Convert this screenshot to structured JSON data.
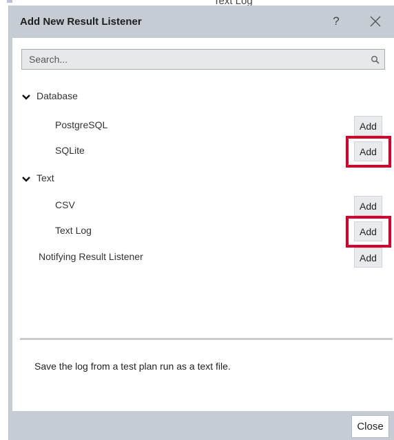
{
  "backdrop": {
    "partial_text": "Text Log"
  },
  "dialog": {
    "title": "Add New Result Listener",
    "help_label": "?",
    "close_label": "Close"
  },
  "search": {
    "placeholder": "Search...",
    "value": ""
  },
  "tree": {
    "groups": [
      {
        "label": "Database",
        "expanded": true,
        "items": [
          {
            "label": "PostgreSQL",
            "action": "Add",
            "highlighted": false
          },
          {
            "label": "SQLite",
            "action": "Add",
            "highlighted": true
          }
        ]
      },
      {
        "label": "Text",
        "expanded": true,
        "items": [
          {
            "label": "CSV",
            "action": "Add",
            "highlighted": false
          },
          {
            "label": "Text Log",
            "action": "Add",
            "highlighted": true
          }
        ]
      }
    ],
    "standalone": [
      {
        "label": "Notifying Result Listener",
        "action": "Add",
        "highlighted": false
      }
    ]
  },
  "description": "Save the log from a test plan run as a text file.",
  "colors": {
    "dialog_bg": "#c6ccd3",
    "panel_bg": "#ffffff",
    "highlight": "#d6002a"
  }
}
